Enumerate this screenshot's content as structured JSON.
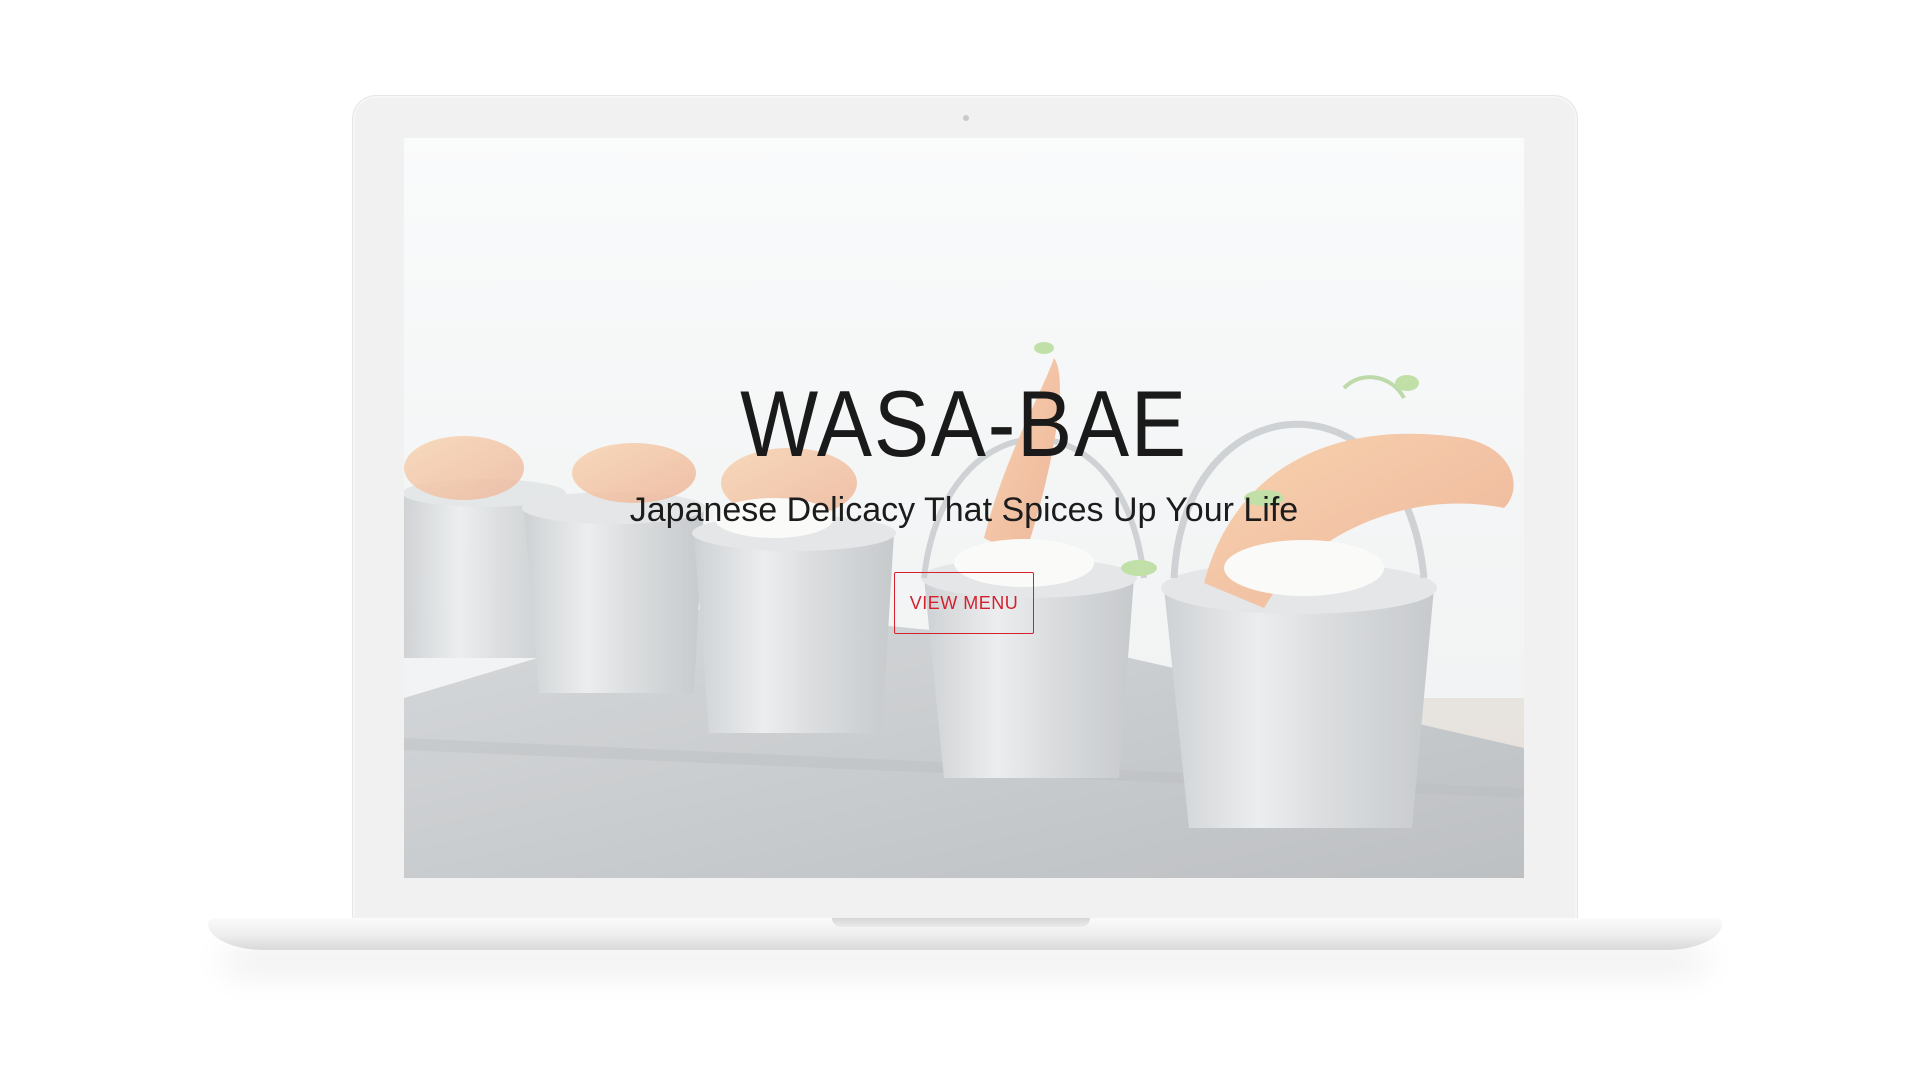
{
  "site": {
    "title": "WASA-BAE",
    "tagline": "Japanese Delicacy That Spices Up Your Life",
    "cta_label": "VIEW MENU"
  },
  "colors": {
    "accent": "#d4212e",
    "text": "#1a1a1a",
    "laptop_frame": "#f1f1f1"
  },
  "hero": {
    "image_subject": "fried shrimp in galvanized mini buckets on a stone board"
  }
}
